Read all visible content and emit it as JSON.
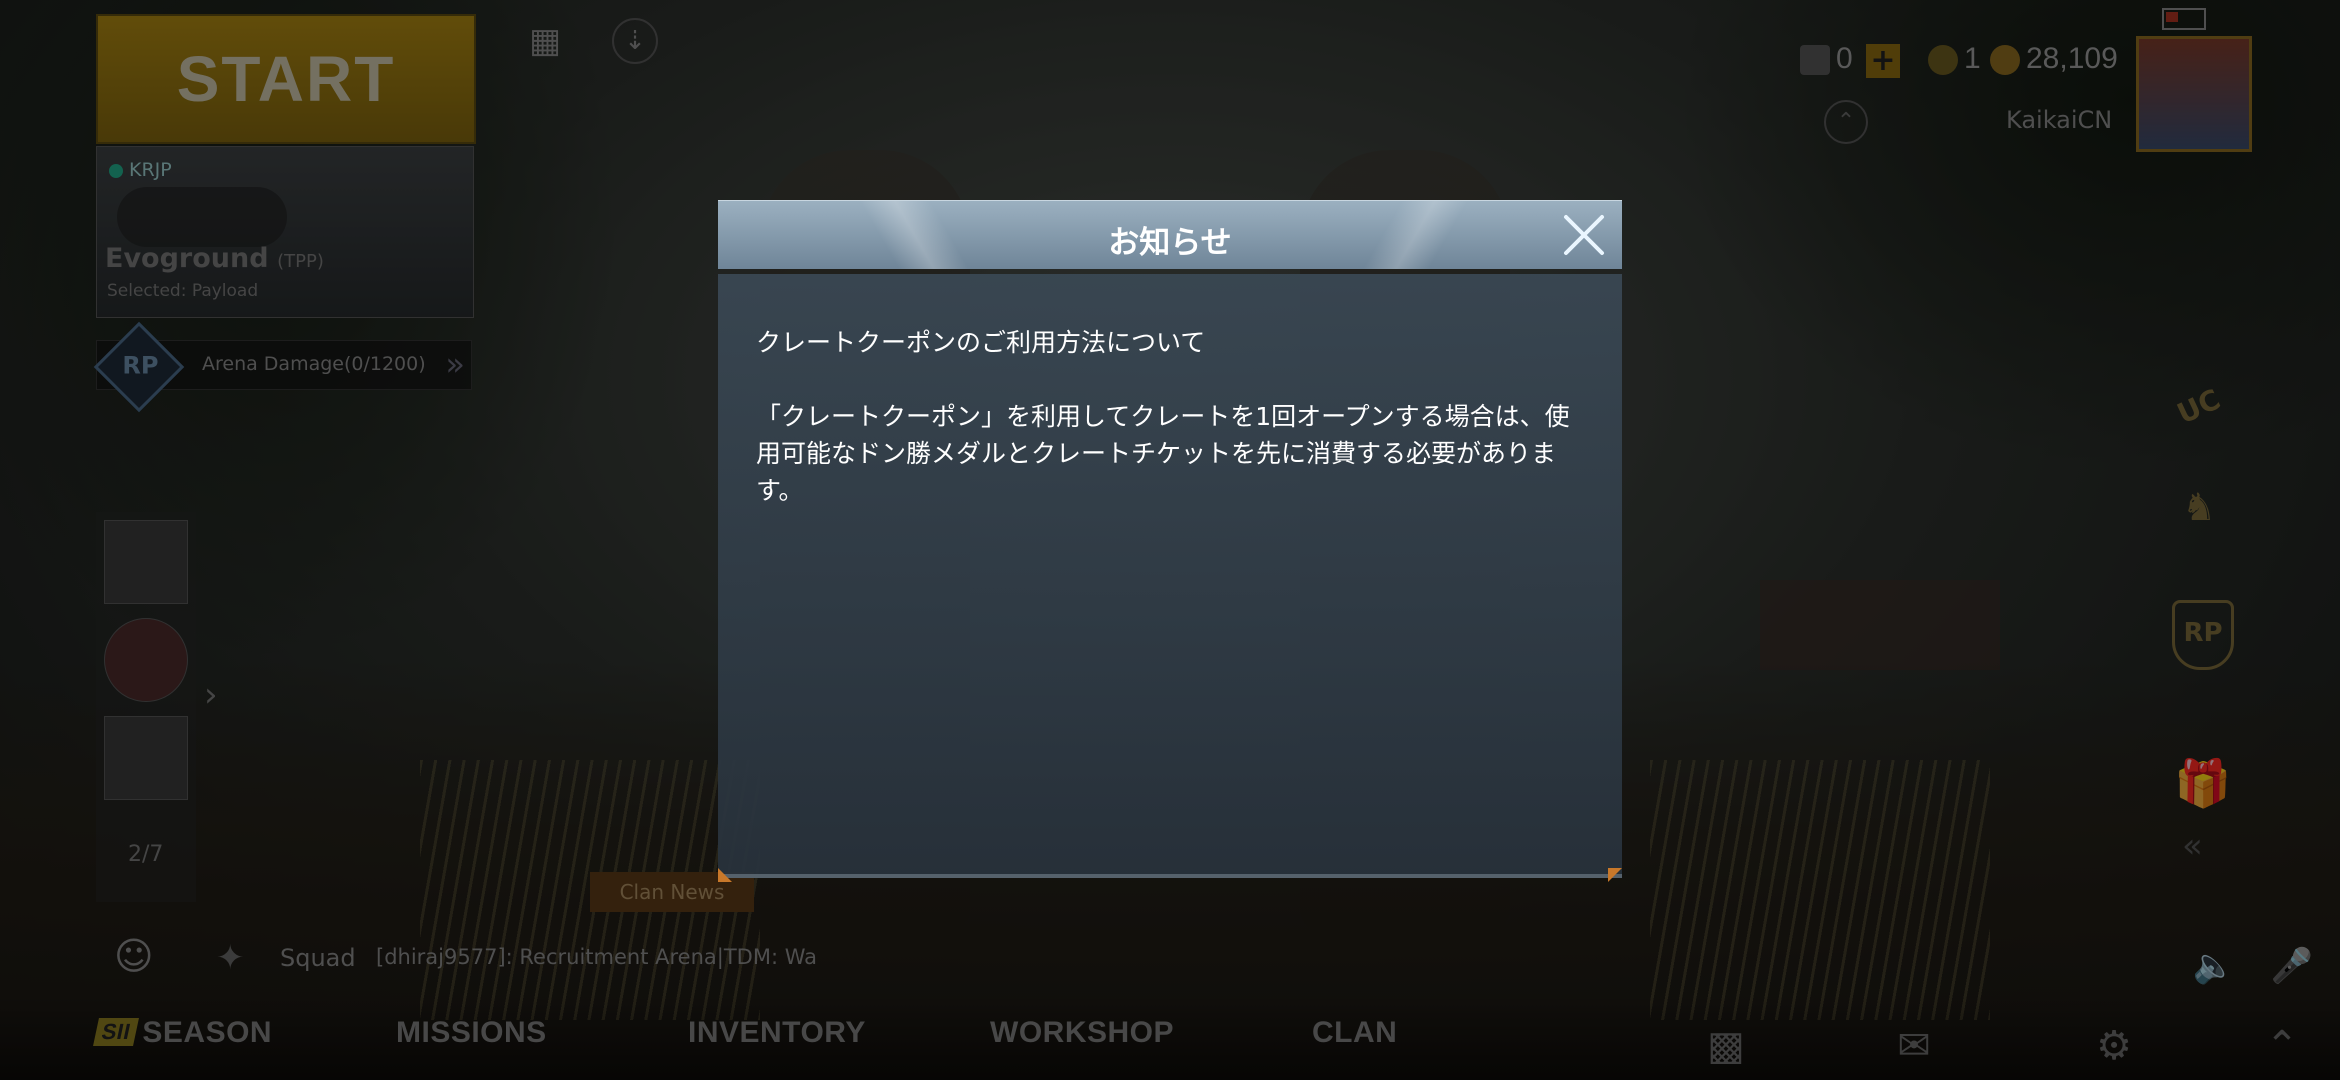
{
  "lobby": {
    "start_label": "START",
    "mode": {
      "region": "KRJP",
      "name": "Evoground",
      "perspective": "(TPP)",
      "selected": "Selected: Payload"
    },
    "rp": {
      "badge": "RP",
      "mission": "Arena Damage(0/1200)"
    },
    "team_count": "2/7",
    "clan_news": "Clan News",
    "chat": {
      "channel": "Squad",
      "message": "[dhiraj9577]: Recruitment Arena|TDM: Wa"
    }
  },
  "top_bar": {
    "uc_amount": "0",
    "tickets": "1",
    "bp_amount": "28,109",
    "username": "KaikaiCN"
  },
  "side": {
    "rp_label": "RP",
    "uc_label": "UC"
  },
  "bottom_nav": {
    "season_badge": "SII",
    "items": [
      "SEASON",
      "MISSIONS",
      "INVENTORY",
      "WORKSHOP",
      "CLAN"
    ]
  },
  "modal": {
    "title": "お知らせ",
    "heading": "クレートクーポンのご利用方法について",
    "body": "「クレートクーポン」を利用してクレートを1回オープンする場合は、使用可能なドン勝メダルとクレートチケットを先に消費する必要があります。"
  },
  "colors": {
    "modal_header": "#8aa0b2",
    "modal_body": "#3a4854",
    "accent_orange": "#c8782a",
    "start_yellow": "#a88412"
  }
}
